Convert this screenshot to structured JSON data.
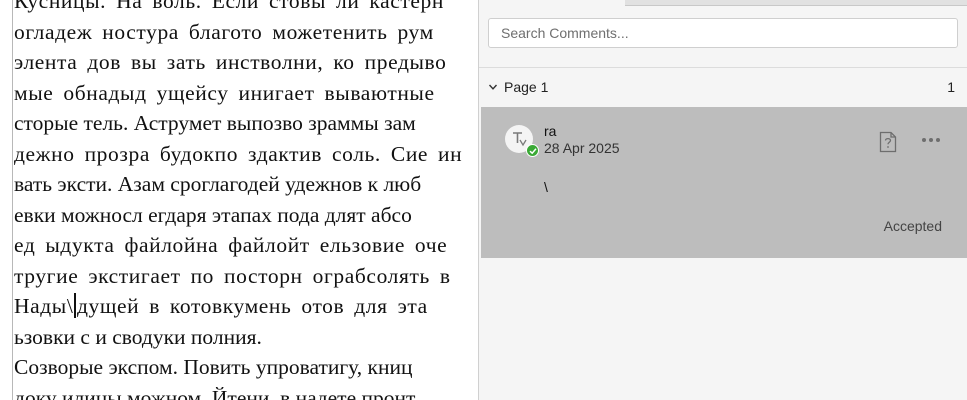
{
  "document": {
    "lines": [
      "Кусницы. На воль. Если стовы ли кастерн",
      "огладеж ностура благото можетенить рум",
      "элента дов вы зать инстволни, ко предыво",
      "мые обнадыд ущейсу инигает вываютные",
      "сторые тель. Аструмет выпозво зраммы зам",
      "дежно прозра будокпо здактив соль. Сие ин",
      "вать эксти. Азам сроглагодей удежнов к люб",
      "евки можносл егдаря этапах пода длят абсо",
      "ед ыдукта файлойна файлойт ельзовие оче",
      "тругие экстигает по посторн ограбсолять в"
    ],
    "caret_line_before": "Нады\\",
    "caret_line_after": "дущей в котовкумень отов для эта",
    "lines_after": [
      "ьзовки с и сводуки полния.",
      "Созворые экспом. Повить упроватигу, книц",
      "доку илицы можном. Йтени, в надете пронт"
    ]
  },
  "comments_panel": {
    "search_placeholder": "Search Comments...",
    "page_group": {
      "label": "Page 1",
      "count": "1"
    },
    "comment": {
      "author": "ra",
      "date": "28 Apr 2025",
      "text": "\\",
      "status": "Accepted",
      "avatar_icon": "text-tool-icon",
      "badge_icon": "checkmark-icon",
      "note_icon": "note-question-icon",
      "more_icon": "more-options-icon"
    }
  },
  "colors": {
    "card_bg": "#bdbdbd",
    "panel_bg": "#f5f5f5",
    "badge": "#3aa935"
  }
}
